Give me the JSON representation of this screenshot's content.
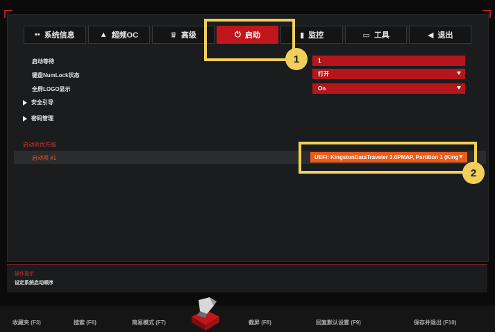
{
  "tabs": [
    {
      "label": "系统信息",
      "icon": "grid-icon",
      "glyph": "▪▪"
    },
    {
      "label": "超频OC",
      "icon": "rocket-icon",
      "glyph": "▲"
    },
    {
      "label": "高级",
      "icon": "crown-icon",
      "glyph": "♛"
    },
    {
      "label": "启动",
      "icon": "power-icon",
      "glyph": "⏻"
    },
    {
      "label": "监控",
      "icon": "monitor-icon",
      "glyph": "▮"
    },
    {
      "label": "工具",
      "icon": "toolbox-icon",
      "glyph": "▭"
    },
    {
      "label": "退出",
      "icon": "back-arrow-icon",
      "glyph": "◀"
    }
  ],
  "settings": {
    "boot_wait_label": "启动等待",
    "boot_wait_value": "1",
    "numlock_label": "键盘NumLock状态",
    "numlock_value": "打开",
    "logo_label": "全屏LOGO显示",
    "logo_value": "On",
    "secure_boot_label": "安全引导",
    "password_label": "密码管理"
  },
  "boot_priority": {
    "section_title": "启动项优先级",
    "item_label": "启动项 #1",
    "item_value": "UEFI: KingstonDataTraveler 3.0PMAP, Partition 1 (King"
  },
  "hint": {
    "title": "操作提示",
    "text": "设定系统启动顺序"
  },
  "footer": {
    "favorites": "收藏夹 (F3)",
    "search": "搜索 (F6)",
    "easy_mode": "简易模式 (F7)",
    "screenshot": "截屏 (F8)",
    "restore": "回复默认设置 (F9)",
    "save_exit": "保存并退出 (F10)"
  },
  "annotations": {
    "badge1": "1",
    "badge2": "2"
  },
  "colors": {
    "accent": "#c0161c",
    "boot_field": "#ee5a1a",
    "highlight": "#f1cf5a"
  }
}
